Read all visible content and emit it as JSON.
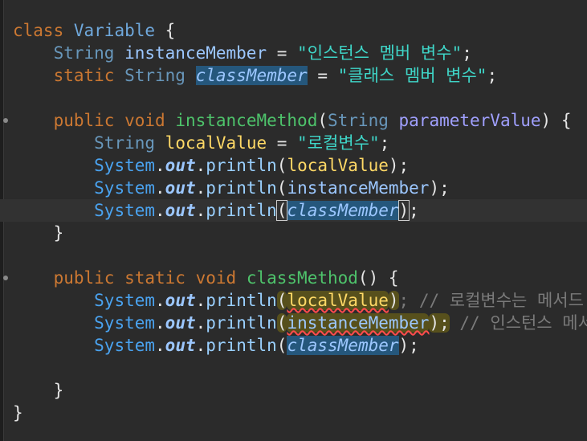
{
  "editor": {
    "lines": [
      {
        "tokens": [
          [
            "class",
            "kw"
          ],
          [
            " ",
            "punc"
          ],
          [
            "Variable",
            "cls"
          ],
          [
            " {",
            "punc"
          ]
        ]
      },
      {
        "tokens": [
          [
            "    ",
            "punc"
          ],
          [
            "String",
            "ty"
          ],
          [
            " ",
            "punc"
          ],
          [
            "instanceMember",
            "field"
          ],
          [
            " = ",
            "punc"
          ],
          [
            "\"인스턴스 멤버 변수\"",
            "str"
          ],
          [
            ";",
            "punc"
          ]
        ]
      },
      {
        "tokens": [
          [
            "    ",
            "punc"
          ],
          [
            "static",
            "kw"
          ],
          [
            " ",
            "punc"
          ],
          [
            "String",
            "ty"
          ],
          [
            " ",
            "punc"
          ],
          [
            "classMember",
            "static-field hl"
          ],
          [
            " = ",
            "punc"
          ],
          [
            "\"클래스 멤버 변수\"",
            "str"
          ],
          [
            ";",
            "punc"
          ]
        ]
      },
      {
        "tokens": []
      },
      {
        "fold": true,
        "tokens": [
          [
            "    ",
            "punc"
          ],
          [
            "public",
            "kw"
          ],
          [
            " ",
            "punc"
          ],
          [
            "void",
            "kw"
          ],
          [
            " ",
            "punc"
          ],
          [
            "instanceMethod",
            "meth"
          ],
          [
            "(",
            "punc"
          ],
          [
            "String",
            "ty"
          ],
          [
            " ",
            "punc"
          ],
          [
            "parameterValue",
            "param"
          ],
          [
            ") {",
            "punc"
          ]
        ]
      },
      {
        "tokens": [
          [
            "        ",
            "punc"
          ],
          [
            "String",
            "ty"
          ],
          [
            " ",
            "punc"
          ],
          [
            "localValue",
            "var"
          ],
          [
            " = ",
            "punc"
          ],
          [
            "\"로컬변수\"",
            "str"
          ],
          [
            ";",
            "punc"
          ]
        ]
      },
      {
        "tokens": [
          [
            "        ",
            "punc"
          ],
          [
            "System",
            "sys"
          ],
          [
            ".",
            "punc"
          ],
          [
            "out",
            "out"
          ],
          [
            ".",
            "punc"
          ],
          [
            "println",
            "call"
          ],
          [
            "(",
            "punc"
          ],
          [
            "localValue",
            "var"
          ],
          [
            ");",
            "punc"
          ]
        ]
      },
      {
        "tokens": [
          [
            "        ",
            "punc"
          ],
          [
            "System",
            "sys"
          ],
          [
            ".",
            "punc"
          ],
          [
            "out",
            "out"
          ],
          [
            ".",
            "punc"
          ],
          [
            "println",
            "call"
          ],
          [
            "(",
            "punc"
          ],
          [
            "instanceMember",
            "field"
          ],
          [
            ");",
            "punc"
          ]
        ]
      },
      {
        "current": true,
        "tokens": [
          [
            "        ",
            "punc"
          ],
          [
            "System",
            "sys"
          ],
          [
            ".",
            "punc"
          ],
          [
            "out",
            "out"
          ],
          [
            ".",
            "punc"
          ],
          [
            "println",
            "call"
          ],
          [
            "(",
            "punc bracket"
          ],
          [
            "classMember",
            "static-field hl"
          ],
          [
            ")",
            "punc bracket"
          ],
          [
            ";",
            "punc"
          ]
        ]
      },
      {
        "tokens": [
          [
            "    }",
            "punc"
          ]
        ]
      },
      {
        "tokens": []
      },
      {
        "fold": true,
        "tokens": [
          [
            "    ",
            "punc"
          ],
          [
            "public",
            "kw"
          ],
          [
            " ",
            "punc"
          ],
          [
            "static",
            "kw"
          ],
          [
            " ",
            "punc"
          ],
          [
            "void",
            "kw"
          ],
          [
            " ",
            "punc"
          ],
          [
            "classMethod",
            "meth"
          ],
          [
            "() {",
            "punc"
          ]
        ]
      },
      {
        "tokens": [
          [
            "        ",
            "punc"
          ],
          [
            "System",
            "sys"
          ],
          [
            ".",
            "punc"
          ],
          [
            "out",
            "out"
          ],
          [
            ".",
            "punc"
          ],
          [
            "println",
            "call"
          ],
          [
            "(",
            "punc err-bg"
          ],
          [
            "localValue",
            "var err err-bg"
          ],
          [
            ")",
            "punc err-bg"
          ],
          [
            "; // 로컬변수는 메서드",
            "comment"
          ]
        ]
      },
      {
        "tokens": [
          [
            "        ",
            "punc"
          ],
          [
            "System",
            "sys"
          ],
          [
            ".",
            "punc"
          ],
          [
            "out",
            "out"
          ],
          [
            ".",
            "punc"
          ],
          [
            "println",
            "call"
          ],
          [
            "(",
            "punc err-bg"
          ],
          [
            "instanceMember",
            "field err err-bg"
          ],
          [
            ");",
            "punc err-bg"
          ],
          [
            " // 인스턴스 메서",
            "comment"
          ]
        ]
      },
      {
        "tokens": [
          [
            "        ",
            "punc"
          ],
          [
            "System",
            "sys"
          ],
          [
            ".",
            "punc"
          ],
          [
            "out",
            "out"
          ],
          [
            ".",
            "punc"
          ],
          [
            "println",
            "call"
          ],
          [
            "(",
            "punc"
          ],
          [
            "classMember",
            "static-field hl"
          ],
          [
            ");",
            "punc"
          ]
        ]
      },
      {
        "tokens": []
      },
      {
        "tokens": [
          [
            "    }",
            "punc"
          ]
        ]
      },
      {
        "tokens": [
          [
            "}",
            "punc"
          ]
        ]
      }
    ]
  }
}
